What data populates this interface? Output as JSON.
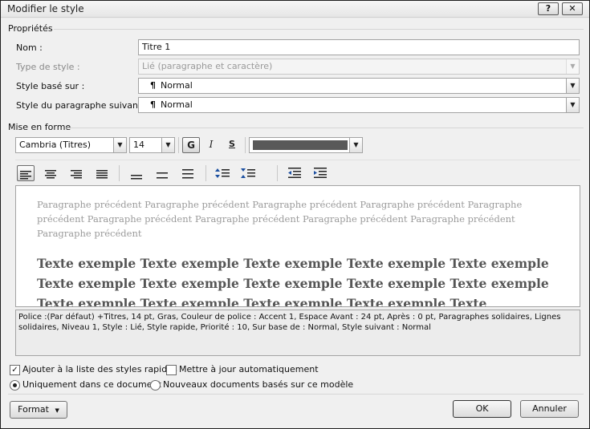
{
  "dialog": {
    "title": "Modifier le style",
    "help_label": "?",
    "close_label": "✕"
  },
  "properties": {
    "section_label": "Propriétés",
    "name_label": "Nom :",
    "name_value": "Titre 1",
    "type_label": "Type de style :",
    "type_value": "Lié (paragraphe et caractère)",
    "based_on_label": "Style basé sur :",
    "based_on_value": "Normal",
    "next_label": "Style du paragraphe suivant :",
    "next_value": "Normal",
    "pilcrow": "¶"
  },
  "formatting": {
    "section_label": "Mise en forme",
    "font": "Cambria (Titres)",
    "size": "14",
    "bold_label": "G",
    "italic_label": "I",
    "underline_label": "S",
    "font_color": "#595959"
  },
  "preview": {
    "previous_text": "Paragraphe précédent Paragraphe précédent Paragraphe précédent Paragraphe précédent Paragraphe précédent Paragraphe précédent Paragraphe précédent Paragraphe précédent Paragraphe précédent Paragraphe précédent",
    "sample_text": "Texte exemple Texte exemple Texte exemple Texte exemple Texte exemple Texte exemple Texte exemple Texte exemple Texte exemple Texte exemple Texte exemple Texte exemple Texte exemple Texte exemple Texte"
  },
  "description": "Police :(Par défaut) +Titres, 14 pt, Gras, Couleur de police : Accent 1, Espace Avant : 24 pt, Après : 0 pt, Paragraphes solidaires, Lignes solidaires, Niveau 1, Style : Lié, Style rapide, Priorité : 10, Sur base de : Normal, Style suivant : Normal",
  "options": {
    "add_quick_styles": {
      "label": "Ajouter à la liste des styles rapides",
      "checked": true
    },
    "auto_update": {
      "label": "Mettre à jour automatiquement",
      "checked": false
    },
    "only_this_doc": {
      "label": "Uniquement dans ce document",
      "selected": true
    },
    "new_docs": {
      "label": "Nouveaux documents basés sur ce modèle",
      "selected": false
    }
  },
  "buttons": {
    "format_label": "Format",
    "ok_label": "OK",
    "cancel_label": "Annuler"
  }
}
